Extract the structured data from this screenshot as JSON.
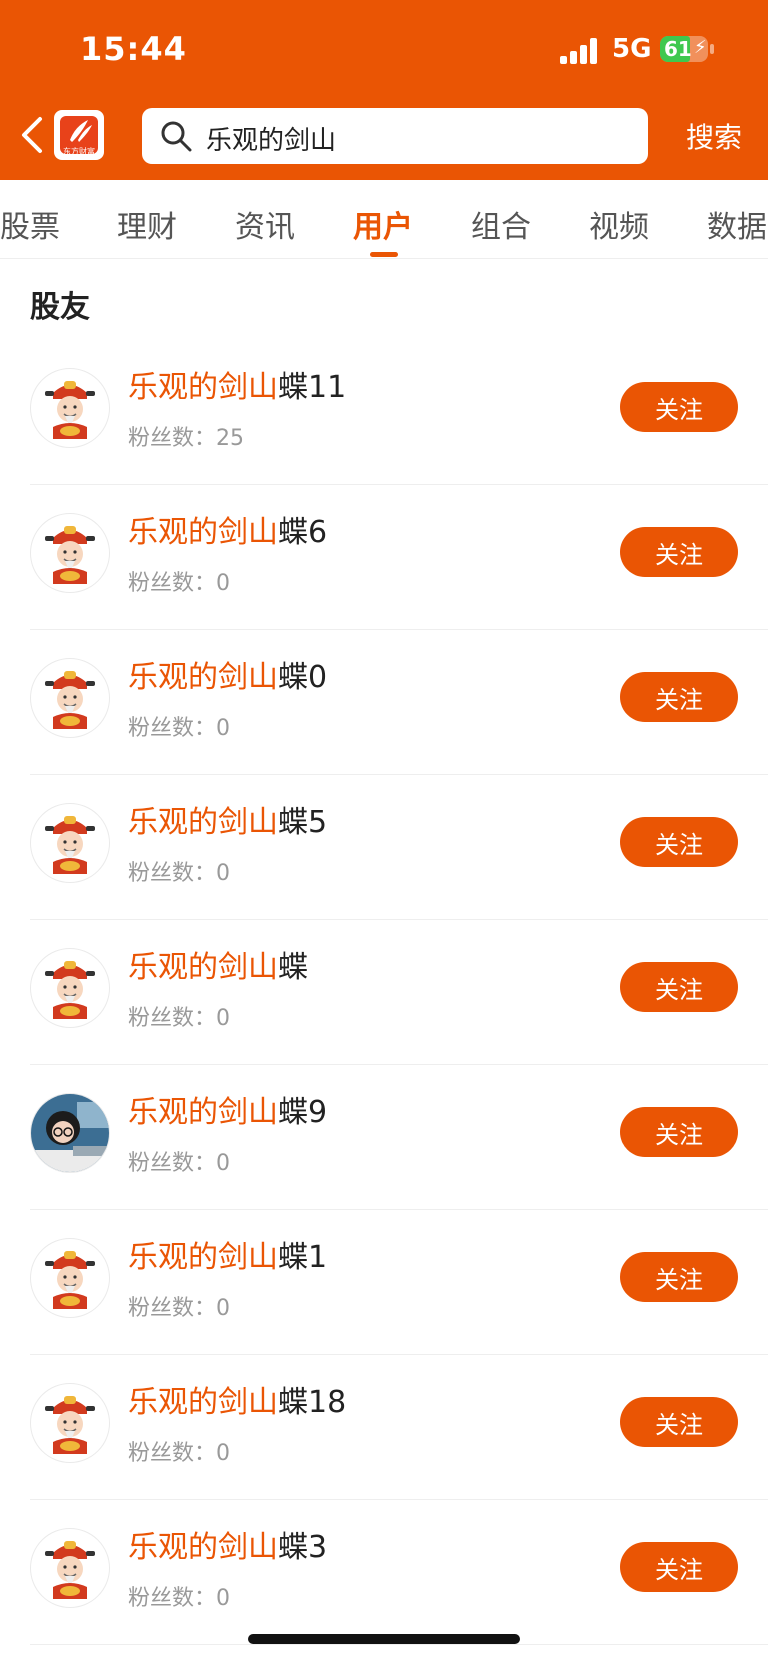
{
  "status_bar": {
    "time": "15:44",
    "network": "5G",
    "battery": "61"
  },
  "header": {
    "back_icon": "chevron-left-icon",
    "app_logo": "东方财富",
    "search_query": "乐观的剑山",
    "search_button": "搜索"
  },
  "tabs": [
    "股票",
    "理财",
    "资讯",
    "用户",
    "组合",
    "视频",
    "数据"
  ],
  "active_tab": "用户",
  "section_title": "股友",
  "users": [
    {
      "highlight": "乐观的剑山",
      "rest": "蝶11",
      "fans_label": "粉丝数：",
      "fans": "25",
      "follow": "关注",
      "avatar": "cartoon-god-of-wealth"
    },
    {
      "highlight": "乐观的剑山",
      "rest": "蝶6",
      "fans_label": "粉丝数：",
      "fans": "0",
      "follow": "关注",
      "avatar": "cartoon-god-of-wealth"
    },
    {
      "highlight": "乐观的剑山",
      "rest": "蝶0",
      "fans_label": "粉丝数：",
      "fans": "0",
      "follow": "关注",
      "avatar": "cartoon-god-of-wealth"
    },
    {
      "highlight": "乐观的剑山",
      "rest": "蝶5",
      "fans_label": "粉丝数：",
      "fans": "0",
      "follow": "关注",
      "avatar": "cartoon-god-of-wealth"
    },
    {
      "highlight": "乐观的剑山",
      "rest": "蝶",
      "fans_label": "粉丝数：",
      "fans": "0",
      "follow": "关注",
      "avatar": "cartoon-god-of-wealth"
    },
    {
      "highlight": "乐观的剑山",
      "rest": "蝶9",
      "fans_label": "粉丝数：",
      "fans": "0",
      "follow": "关注",
      "avatar": "photo-girl-with-glasses"
    },
    {
      "highlight": "乐观的剑山",
      "rest": "蝶1",
      "fans_label": "粉丝数：",
      "fans": "0",
      "follow": "关注",
      "avatar": "cartoon-god-of-wealth"
    },
    {
      "highlight": "乐观的剑山",
      "rest": "蝶18",
      "fans_label": "粉丝数：",
      "fans": "0",
      "follow": "关注",
      "avatar": "cartoon-god-of-wealth"
    },
    {
      "highlight": "乐观的剑山",
      "rest": "蝶3",
      "fans_label": "粉丝数：",
      "fans": "0",
      "follow": "关注",
      "avatar": "cartoon-god-of-wealth"
    }
  ],
  "colors": {
    "accent": "#ea5504",
    "text": "#222222",
    "muted": "#999999"
  }
}
